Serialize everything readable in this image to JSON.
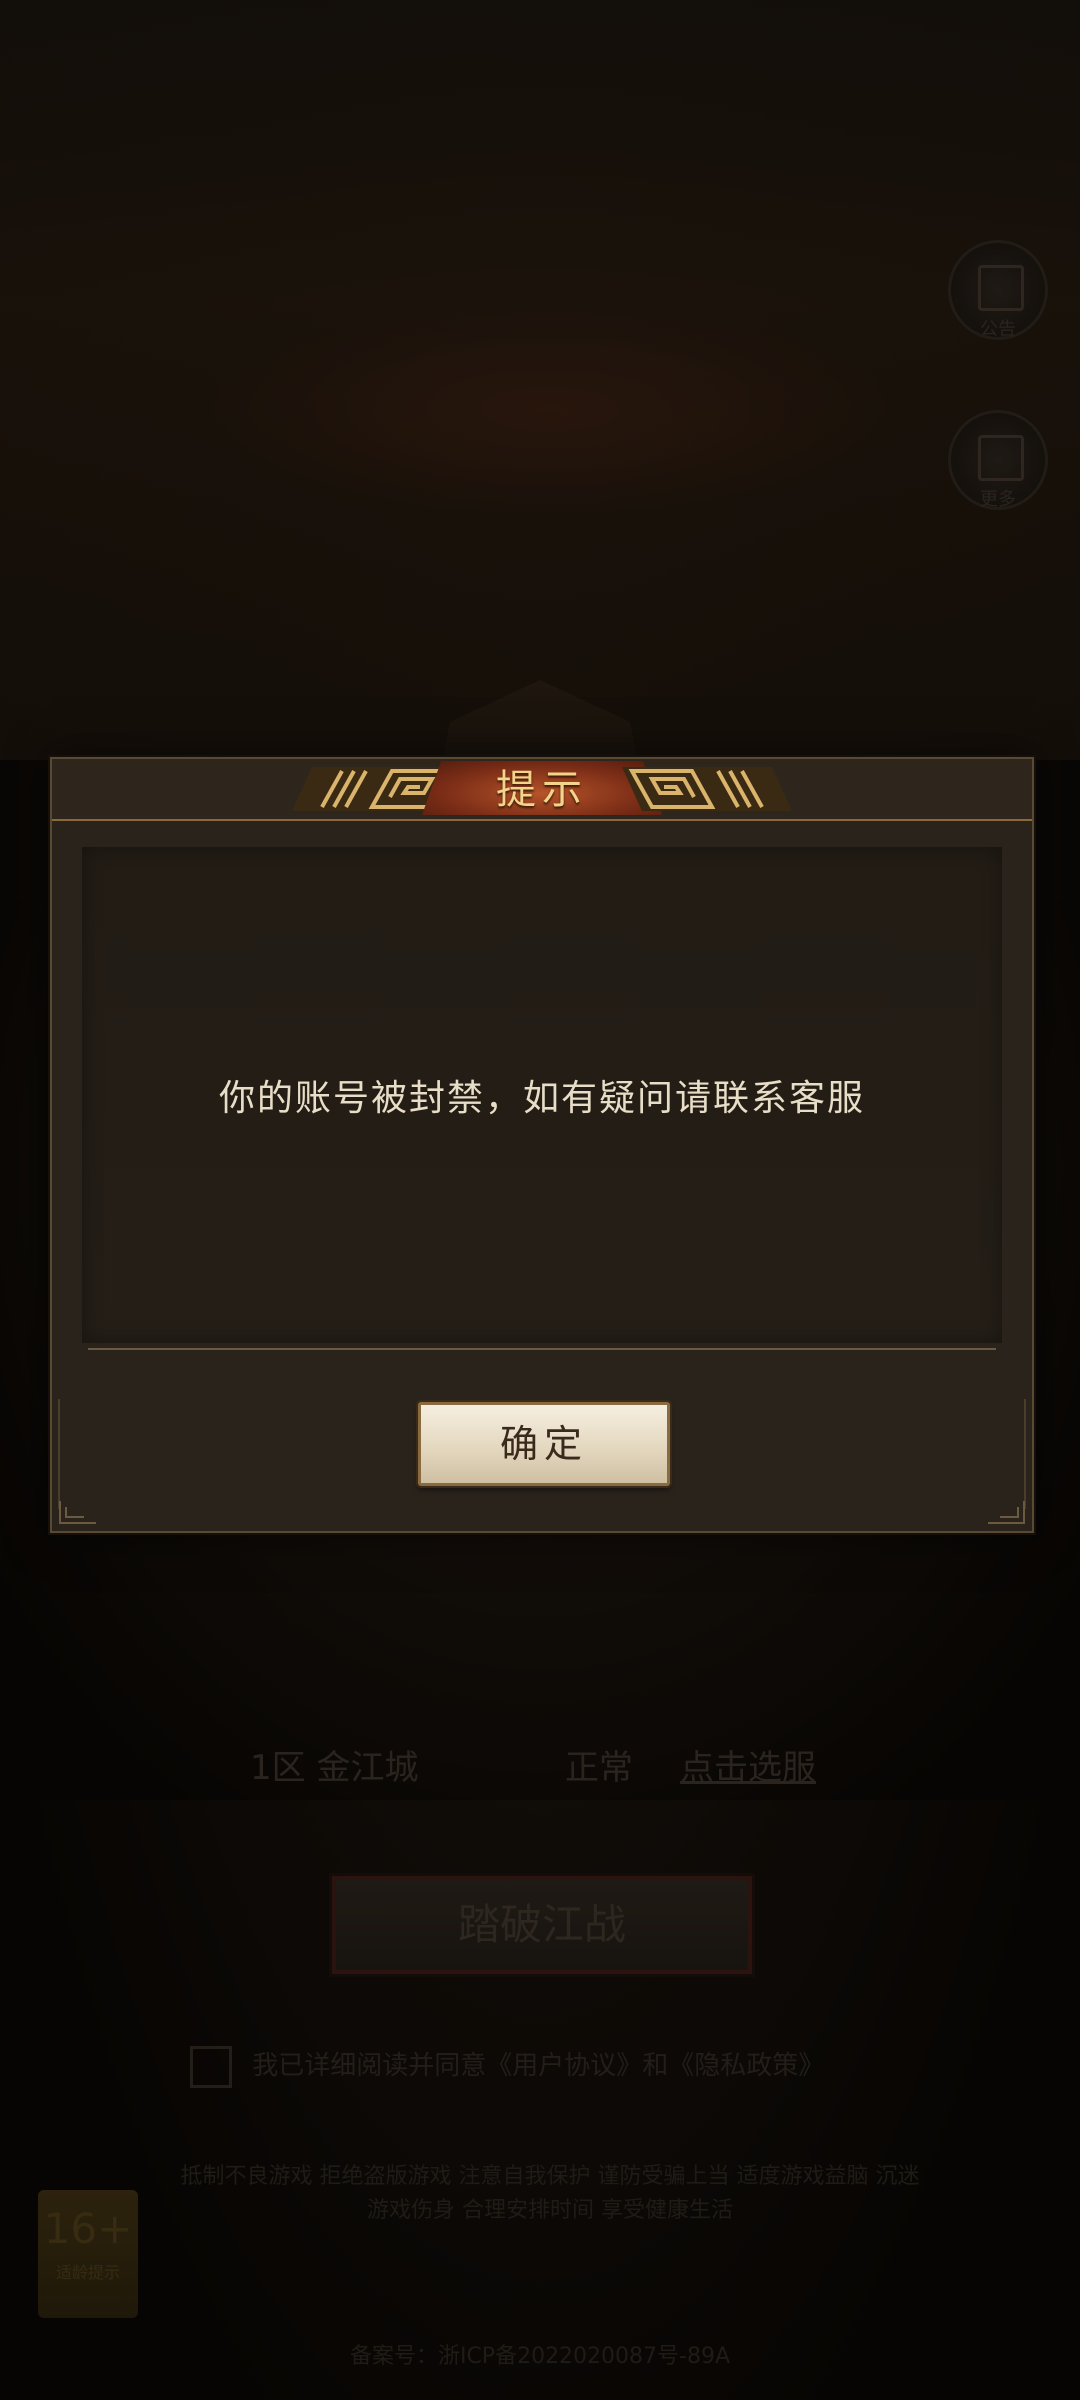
{
  "dialog": {
    "title": "提示",
    "message": "你的账号被封禁，如有疑问请联系客服",
    "confirm_label": "确定"
  },
  "background": {
    "server_label": "1区 金江城",
    "status_label": "正常",
    "select_server_label": "点击选服",
    "enter_button_label": "踏破江战",
    "agreement_text": "我已详细阅读并同意《用户协议》和《隐私政策》",
    "age_rating": "16+",
    "age_rating_caption": "适龄提示",
    "side_button_1_label": "公告",
    "side_button_2_label": "更多",
    "health_notice": "抵制不良游戏 拒绝盗版游戏 注意自我保护 谨防受骗上当 适度游戏益脑 沉迷游戏伤身 合理安排时间 享受健康生活",
    "record_number": "备案号：浙ICP备2022020087号-89A"
  }
}
